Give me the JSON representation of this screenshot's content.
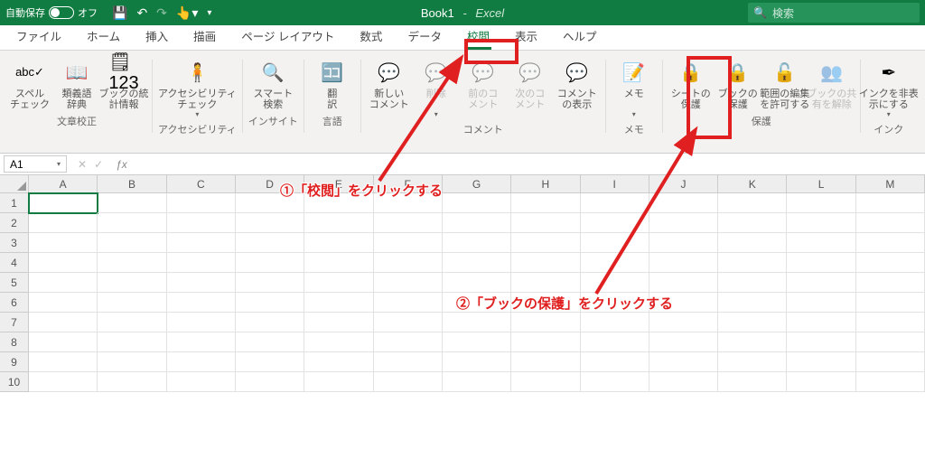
{
  "title": {
    "autosave_label": "自動保存",
    "autosave_state": "オフ",
    "workbook": "Book1",
    "app": "Excel",
    "search_placeholder": "検索"
  },
  "tabs": [
    "ファイル",
    "ホーム",
    "挿入",
    "描画",
    "ページ レイアウト",
    "数式",
    "データ",
    "校閲",
    "表示",
    "ヘルプ"
  ],
  "active_tab_index": 7,
  "ribbon": {
    "groups": [
      {
        "name": "文章校正",
        "items": [
          {
            "key": "spell",
            "label": "スペル\nチェック",
            "disabled": false,
            "icon": "abc"
          },
          {
            "key": "thesaurus",
            "label": "類義語\n辞典",
            "disabled": false,
            "icon": "book"
          },
          {
            "key": "stats",
            "label": "ブックの統\n計情報",
            "disabled": false,
            "icon": "stats",
            "chev": false
          }
        ]
      },
      {
        "name": "アクセシビリティ",
        "items": [
          {
            "key": "a11y",
            "label": "アクセシビリティ\nチェック",
            "disabled": false,
            "icon": "a11y",
            "chev": true
          }
        ]
      },
      {
        "name": "インサイト",
        "items": [
          {
            "key": "smart",
            "label": "スマート\n検索",
            "disabled": false,
            "icon": "search"
          }
        ]
      },
      {
        "name": "言語",
        "items": [
          {
            "key": "translate",
            "label": "翻\n訳",
            "disabled": false,
            "icon": "translate"
          }
        ]
      },
      {
        "name": "コメント",
        "items": [
          {
            "key": "newc",
            "label": "新しい\nコメント",
            "disabled": false,
            "icon": "comment-plus"
          },
          {
            "key": "delc",
            "label": "削除",
            "disabled": true,
            "icon": "comment-x",
            "chev": true
          },
          {
            "key": "prevc",
            "label": "前のコ\nメント",
            "disabled": true,
            "icon": "comment-prev"
          },
          {
            "key": "nextc",
            "label": "次のコ\nメント",
            "disabled": true,
            "icon": "comment-next"
          },
          {
            "key": "showc",
            "label": "コメント\nの表示",
            "disabled": false,
            "icon": "comment"
          }
        ]
      },
      {
        "name": "メモ",
        "items": [
          {
            "key": "memo",
            "label": "メモ",
            "disabled": false,
            "icon": "memo",
            "chev": true
          }
        ]
      },
      {
        "name": "保護",
        "items": [
          {
            "key": "psheet",
            "label": "シートの\n保護",
            "disabled": false,
            "icon": "lock-sheet"
          },
          {
            "key": "pbook",
            "label": "ブックの\n保護",
            "disabled": false,
            "icon": "lock-book"
          },
          {
            "key": "prange",
            "label": "範囲の編集\nを許可する",
            "disabled": false,
            "icon": "lock-range"
          },
          {
            "key": "pshare",
            "label": "ブックの共\n有を解除",
            "disabled": true,
            "icon": "share"
          }
        ]
      },
      {
        "name": "インク",
        "items": [
          {
            "key": "ink",
            "label": "インクを非表\n示にする",
            "disabled": false,
            "icon": "ink",
            "chev": true
          }
        ]
      }
    ]
  },
  "name_box": "A1",
  "columns": [
    "A",
    "B",
    "C",
    "D",
    "E",
    "F",
    "G",
    "H",
    "I",
    "J",
    "K",
    "L",
    "M"
  ],
  "rows": [
    1,
    2,
    3,
    4,
    5,
    6,
    7,
    8,
    9,
    10
  ],
  "annotations": {
    "text1": "①「校閲」をクリックする",
    "text2": "②「ブックの保護」をクリックする"
  },
  "icon_glyphs": {
    "abc": "abc✓",
    "book": "📖",
    "stats": "🗒123",
    "a11y": "🧍",
    "search": "🔍",
    "translate": "🈁",
    "comment-plus": "💬",
    "comment-x": "💬",
    "comment-prev": "💬",
    "comment-next": "💬",
    "comment": "💬",
    "memo": "📝",
    "lock-sheet": "🔒",
    "lock-book": "🔒",
    "lock-range": "🔓",
    "share": "👥",
    "ink": "✒"
  }
}
